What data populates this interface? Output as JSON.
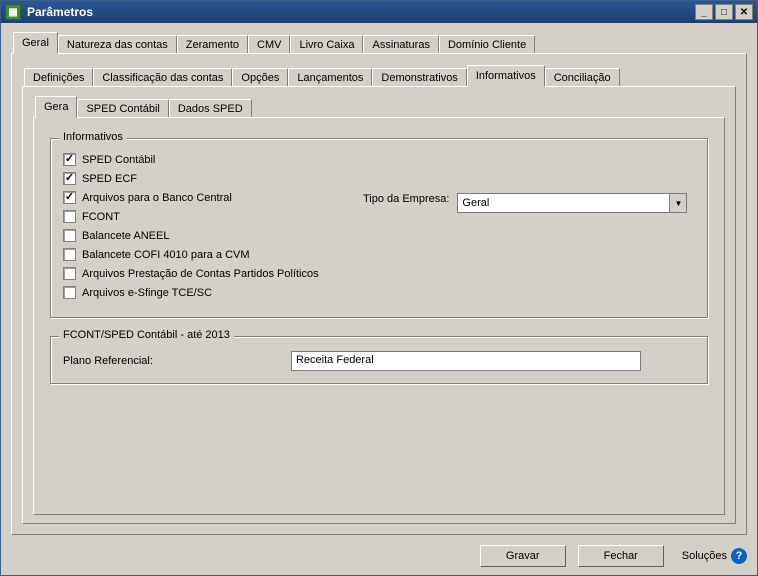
{
  "window": {
    "title": "Parâmetros"
  },
  "tabs_level1": [
    {
      "label": "Geral",
      "active": true
    },
    {
      "label": "Natureza das contas"
    },
    {
      "label": "Zeramento"
    },
    {
      "label": "CMV"
    },
    {
      "label": "Livro Caixa"
    },
    {
      "label": "Assinaturas"
    },
    {
      "label": "Domínio Cliente"
    }
  ],
  "tabs_level2": [
    {
      "label": "Definições"
    },
    {
      "label": "Classificação das contas"
    },
    {
      "label": "Opções"
    },
    {
      "label": "Lançamentos"
    },
    {
      "label": "Demonstrativos"
    },
    {
      "label": "Informativos",
      "active": true
    },
    {
      "label": "Conciliação"
    }
  ],
  "tabs_level3": [
    {
      "label": "Gera",
      "active": true
    },
    {
      "label": "SPED Contábil"
    },
    {
      "label": "Dados SPED"
    }
  ],
  "group_informativos": {
    "title": "Informativos",
    "checks": [
      {
        "label": "SPED Contábil",
        "checked": true
      },
      {
        "label": "SPED ECF",
        "checked": true
      },
      {
        "label": "Arquivos para o Banco Central",
        "checked": true
      },
      {
        "label": "FCONT",
        "checked": false
      },
      {
        "label": "Balancete ANEEL",
        "checked": false
      },
      {
        "label": "Balancete COFI 4010 para a CVM",
        "checked": false
      },
      {
        "label": "Arquivos Prestação de Contas Partidos Políticos",
        "checked": false
      },
      {
        "label": "Arquivos e-Sfinge TCE/SC",
        "checked": false
      }
    ],
    "tipo_empresa_label": "Tipo da Empresa:",
    "tipo_empresa_value": "Geral"
  },
  "group_fcont": {
    "title": "FCONT/SPED Contábil - até 2013",
    "plano_label": "Plano Referencial:",
    "plano_value": "Receita Federal"
  },
  "buttons": {
    "gravar": "Gravar",
    "fechar": "Fechar",
    "solucoes": "Soluções"
  }
}
